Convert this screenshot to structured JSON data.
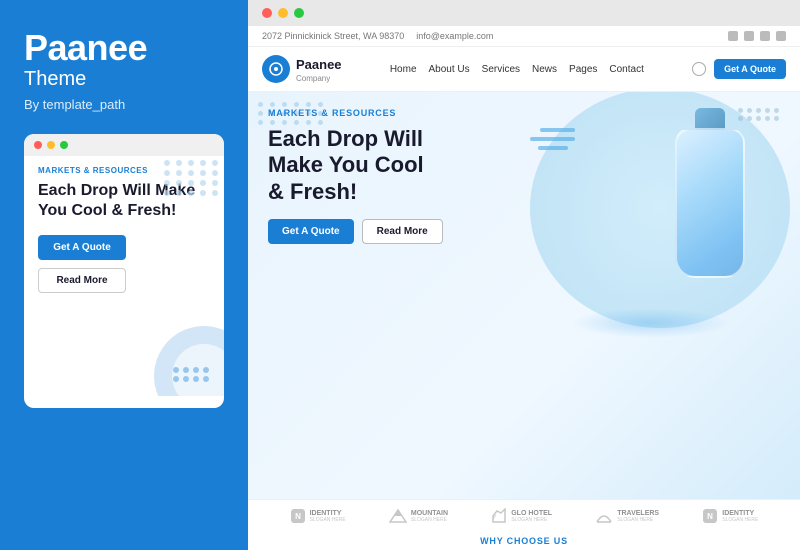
{
  "left": {
    "brand_name": "Paanee",
    "brand_theme": "Theme",
    "brand_by": "By template_path",
    "mini": {
      "markets_label": "MARKETS & RESOURCES",
      "heading": "Each Drop Will Make You Cool & Fresh!",
      "btn_quote": "Get A Quote",
      "btn_read": "Read More"
    }
  },
  "browser": {
    "topbar": {
      "address": "2072 Pinnickinick Street, WA 98370",
      "email": "info@example.com"
    },
    "nav": {
      "logo_name": "Paanee",
      "logo_company": "Company",
      "links": [
        "Home",
        "About Us",
        "Services",
        "News",
        "Pages",
        "Contact"
      ],
      "cta": "Get A Quote"
    },
    "hero": {
      "markets_label": "MARKETS & RESOURCES",
      "heading_line1": "Each Drop Will",
      "heading_line2": "Make You Cool",
      "heading_line3": "& Fresh!",
      "btn_quote": "Get A Quote",
      "btn_read": "Read More"
    },
    "brands": [
      {
        "name": "IDENTITY",
        "sub": "SLOGAN HERE"
      },
      {
        "name": "MOUNTAIN",
        "sub": "SLOGAN HERE"
      },
      {
        "name": "GLO HOTEL",
        "sub": "SLOGAN HERE"
      },
      {
        "name": "TRAVELERS",
        "sub": "SLOGAN HERE"
      },
      {
        "name": "IDENTITY",
        "sub": "SLOGAN HERE"
      }
    ],
    "why_label": "WHY CHOOSE US"
  }
}
